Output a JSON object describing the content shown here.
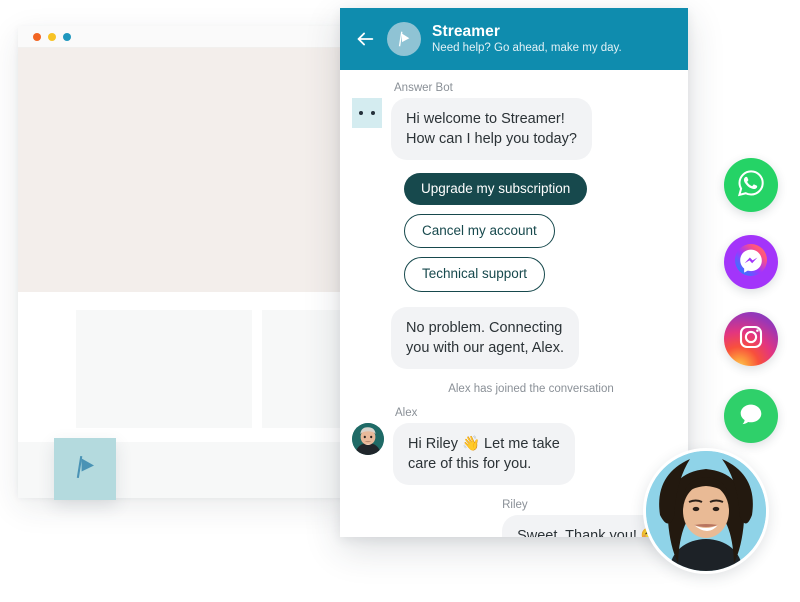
{
  "browser_window": {
    "name": "background-website-window",
    "traffic_lights": [
      "red",
      "yellow",
      "blue"
    ],
    "launcher_icon": "flag-icon"
  },
  "chat": {
    "header": {
      "back_icon": "back-arrow-icon",
      "logo_icon": "flag-logo-icon",
      "title": "Streamer",
      "subtitle": "Need help? Go ahead, make my day.",
      "background_color": "#0f8cae"
    },
    "messages": [
      {
        "sender": "Answer Bot",
        "avatar": "bot-face-avatar",
        "text": "Hi welcome to Streamer!\nHow can I help you today?",
        "align": "left"
      },
      {
        "sender": "",
        "avatar": "",
        "text": "No problem. Connecting\nyou with our agent, Alex.",
        "align": "left"
      },
      {
        "sender": "Alex",
        "avatar": "alex-agent-photo",
        "text": "Hi Riley 👋 Let me take\ncare of this for you.",
        "align": "left"
      },
      {
        "sender": "Riley",
        "avatar": "",
        "text": "Sweet. Thank you! 😊",
        "align": "right"
      }
    ],
    "quick_replies": [
      {
        "label": "Upgrade my subscription",
        "style": "primary"
      },
      {
        "label": "Cancel my account",
        "style": "ghost"
      },
      {
        "label": "Technical support",
        "style": "ghost"
      }
    ],
    "system_note": "Alex has joined the conversation",
    "colors": {
      "primary_chip": "#17494d",
      "bubble": "#f2f3f5",
      "header": "#0f8cae"
    }
  },
  "social_rail": {
    "items": [
      {
        "name": "whatsapp",
        "icon": "whatsapp-icon",
        "color": "#25d366"
      },
      {
        "name": "messenger",
        "icon": "messenger-icon",
        "color": "#a334fa"
      },
      {
        "name": "instagram",
        "icon": "instagram-icon",
        "color": "#e3357f"
      },
      {
        "name": "chat",
        "icon": "chat-bubble-icon",
        "color": "#2fd06a"
      }
    ]
  },
  "riley_photo": {
    "name": "riley-customer-photo",
    "background_color": "#8fd3e8"
  }
}
